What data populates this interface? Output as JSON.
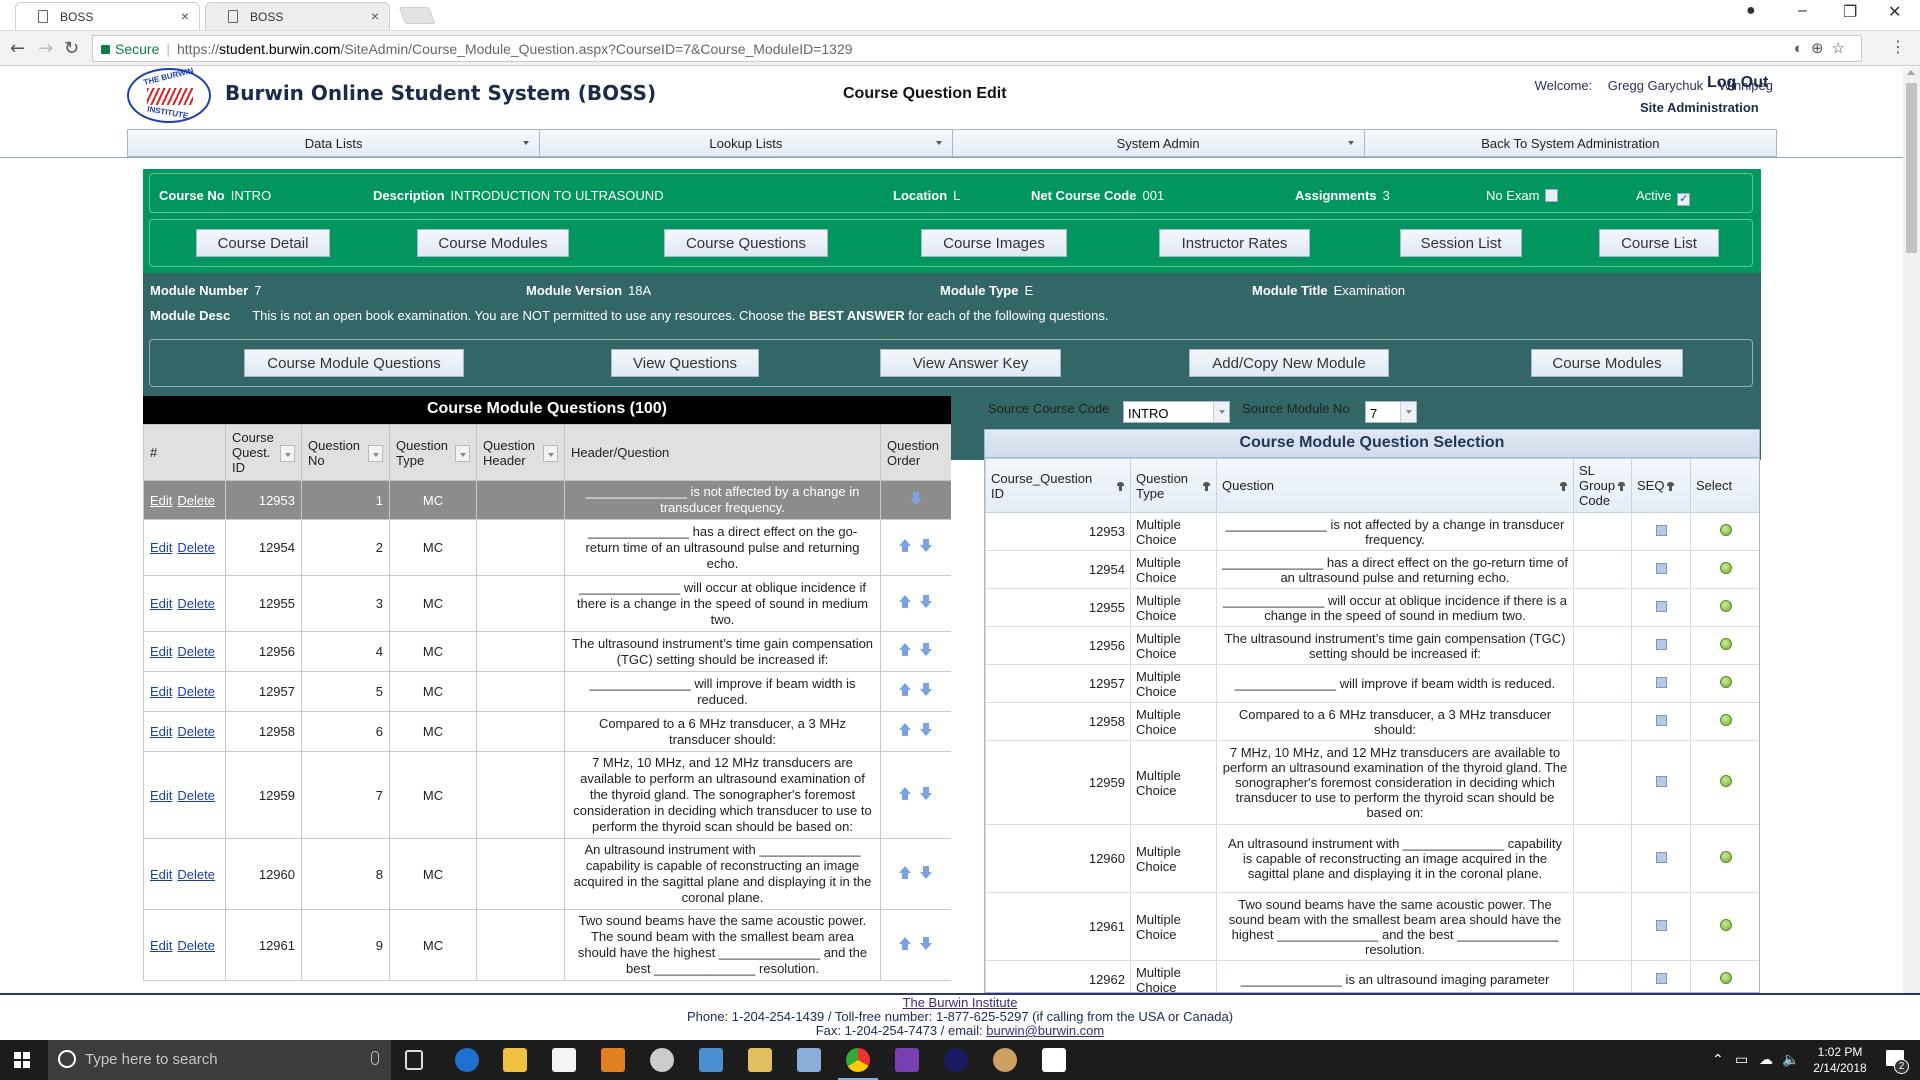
{
  "browser": {
    "tabs": [
      {
        "label": "BOSS",
        "active": true
      },
      {
        "label": "BOSS",
        "active": false
      }
    ],
    "secure_label": "Secure",
    "url_scheme": "https://",
    "url_host": "student.burwin.com",
    "url_path": "/SiteAdmin/Course_Module_Question.aspx?CourseID=7&Course_ModuleID=1329"
  },
  "header": {
    "logo_top": "THE BURWIN",
    "logo_bottom": "INSTITUTE",
    "app_title": "Burwin Online Student System (BOSS)",
    "page_title": "Course Question Edit",
    "welcome_label": "Welcome:",
    "user_name": "Gregg Garychuk",
    "location": "Winnipeg",
    "logout_label": "Log Out",
    "site_admin_label": "Site Administration"
  },
  "menu": [
    {
      "label": "Data Lists",
      "dropdown": true
    },
    {
      "label": "Lookup Lists",
      "dropdown": true
    },
    {
      "label": "System Admin",
      "dropdown": true
    },
    {
      "label": "Back To System Administration",
      "dropdown": false
    }
  ],
  "course": {
    "course_no_label": "Course No",
    "course_no": "INTRO",
    "description_label": "Description",
    "description": "INTRODUCTION TO ULTRASOUND",
    "location_label": "Location",
    "location": "L",
    "net_course_code_label": "Net Course Code",
    "net_course_code": "001",
    "assignments_label": "Assignments",
    "assignments": "3",
    "no_exam_label": "No Exam",
    "no_exam_checked": false,
    "active_label": "Active",
    "active_checked": true,
    "buttons": [
      "Course Detail",
      "Course Modules",
      "Course Questions",
      "Course Images",
      "Instructor Rates",
      "Session List",
      "Course List"
    ]
  },
  "module": {
    "number_label": "Module Number",
    "number": "7",
    "version_label": "Module Version",
    "version": "18A",
    "type_label": "Module Type",
    "type": "E",
    "title_label": "Module Title",
    "title": "Examination",
    "desc_label": "Module Desc",
    "desc_pre": "This is not an open book examination. You are NOT permitted to use any resources. Choose the ",
    "desc_bold": "BEST ANSWER",
    "desc_post": " for each of the following questions.",
    "buttons": [
      "Course Module Questions",
      "View Questions",
      "View Answer Key",
      "Add/Copy New Module",
      "Course Modules"
    ]
  },
  "left_grid": {
    "title": "Course Module Questions (100)",
    "columns": [
      "#",
      "Course Quest. ID",
      "Question No",
      "Question Type",
      "Question Header",
      "Header/Question",
      "Question Order"
    ],
    "edit_label": "Edit",
    "delete_label": "Delete",
    "rows": [
      {
        "id": "12953",
        "no": "1",
        "type": "MC",
        "header": "",
        "question": "______________ is not affected by a change in transducer frequency.",
        "selected": true
      },
      {
        "id": "12954",
        "no": "2",
        "type": "MC",
        "header": "",
        "question": "______________ has a direct effect on the go-return time of an ultrasound pulse and returning echo.",
        "selected": false
      },
      {
        "id": "12955",
        "no": "3",
        "type": "MC",
        "header": "",
        "question": "______________ will occur at oblique incidence if there is a change in the speed of sound in medium two.",
        "selected": false
      },
      {
        "id": "12956",
        "no": "4",
        "type": "MC",
        "header": "",
        "question": "The ultrasound instrument’s time gain compensation (TGC) setting should be increased if:",
        "selected": false
      },
      {
        "id": "12957",
        "no": "5",
        "type": "MC",
        "header": "",
        "question": "______________ will improve if beam width is reduced.",
        "selected": false
      },
      {
        "id": "12958",
        "no": "6",
        "type": "MC",
        "header": "",
        "question": "Compared to a 6 MHz transducer, a 3 MHz transducer should:",
        "selected": false
      },
      {
        "id": "12959",
        "no": "7",
        "type": "MC",
        "header": "",
        "question": "7 MHz, 10 MHz, and 12 MHz transducers are available to perform an ultrasound examination of the thyroid gland. The sonographer's foremost consideration in deciding which transducer to use to perform the thyroid scan should be based on:",
        "selected": false
      },
      {
        "id": "12960",
        "no": "8",
        "type": "MC",
        "header": "",
        "question": "An ultrasound instrument with ______________ capability is capable of reconstructing an image acquired in the sagittal plane and displaying it in the coronal plane.",
        "selected": false
      },
      {
        "id": "12961",
        "no": "9",
        "type": "MC",
        "header": "",
        "question": "Two sound beams have the same acoustic power. The sound beam with the smallest beam area should have the highest ______________ and the best ______________ resolution.",
        "selected": false
      }
    ]
  },
  "source": {
    "course_code_label": "Source Course Code",
    "course_code": "INTRO",
    "module_no_label": "Source Module No",
    "module_no": "7"
  },
  "right_grid": {
    "title": "Course Module Question Selection",
    "columns": [
      "Course_Question ID",
      "Question Type",
      "Question",
      "SL Group Code",
      "SEQ",
      "Select"
    ],
    "rows": [
      {
        "id": "12953",
        "type": "Multiple Choice",
        "question": "______________ is not affected by a change in transducer frequency."
      },
      {
        "id": "12954",
        "type": "Multiple Choice",
        "question": "______________ has a direct effect on the go-return time of an ultrasound pulse and returning echo."
      },
      {
        "id": "12955",
        "type": "Multiple Choice",
        "question": "______________ will occur at oblique incidence if there is a change in the speed of sound in medium two."
      },
      {
        "id": "12956",
        "type": "Multiple Choice",
        "question": "The ultrasound instrument’s time gain compensation (TGC) setting should be increased if:"
      },
      {
        "id": "12957",
        "type": "Multiple Choice",
        "question": "______________ will improve if beam width is reduced."
      },
      {
        "id": "12958",
        "type": "Multiple Choice",
        "question": "Compared to a 6 MHz transducer, a 3 MHz transducer should:"
      },
      {
        "id": "12959",
        "type": "Multiple Choice",
        "question": "7 MHz, 10 MHz, and 12 MHz transducers are available to perform an ultrasound examination of the thyroid gland. The sonographer's foremost consideration in deciding which transducer to use to perform the thyroid scan should be based on:"
      },
      {
        "id": "12960",
        "type": "Multiple Choice",
        "question": "An ultrasound instrument with ______________ capability is capable of reconstructing an image acquired in the sagittal plane and displaying it in the coronal plane."
      },
      {
        "id": "12961",
        "type": "Multiple Choice",
        "question": "Two sound beams have the same acoustic power. The sound beam with the smallest beam area should have the highest ______________ and the best ______________ resolution."
      },
      {
        "id": "12962",
        "type": "Multiple Choice",
        "question": "______________ is an ultrasound imaging parameter"
      }
    ]
  },
  "footer": {
    "institute_link": "The Burwin Institute",
    "phone_line": "Phone: 1-204-254-1439 / Toll-free number: 1-877-625-5297 (if calling from the USA or Canada)",
    "fax_prefix": "Fax: 1-204-254-7473 / email: ",
    "email": "burwin@burwin.com"
  },
  "taskbar": {
    "search_placeholder": "Type here to search",
    "time": "1:02 PM",
    "date": "2/14/2018",
    "notification_count": "2"
  }
}
